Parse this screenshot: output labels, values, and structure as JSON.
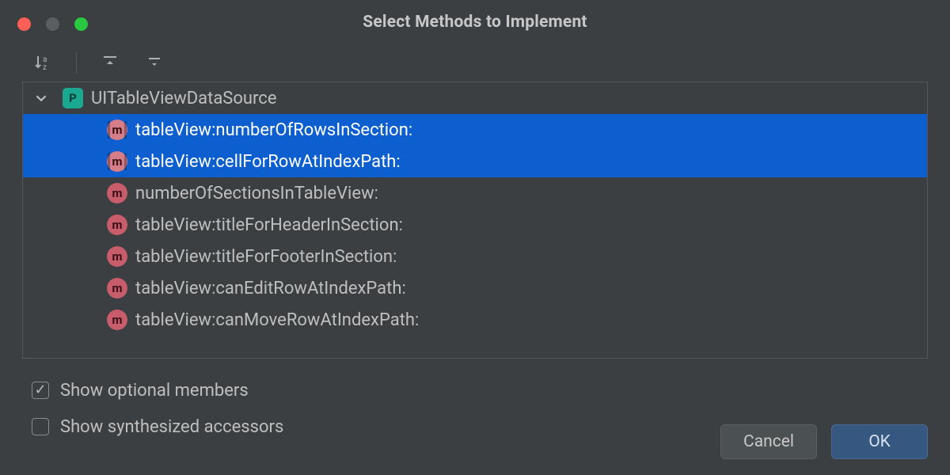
{
  "title": "Select Methods to Implement",
  "toolbar": {
    "sort_az": "sort-alpha",
    "expand_all": "expand-all",
    "collapse_all": "collapse-all"
  },
  "tree": {
    "protocol": {
      "badge": "P",
      "name": "UITableViewDataSource",
      "expanded": true
    },
    "methods": [
      {
        "badge": "m",
        "name": "tableView:numberOfRowsInSection:",
        "selected": true
      },
      {
        "badge": "m",
        "name": "tableView:cellForRowAtIndexPath:",
        "selected": true
      },
      {
        "badge": "m",
        "name": "numberOfSectionsInTableView:",
        "selected": false
      },
      {
        "badge": "m",
        "name": "tableView:titleForHeaderInSection:",
        "selected": false
      },
      {
        "badge": "m",
        "name": "tableView:titleForFooterInSection:",
        "selected": false
      },
      {
        "badge": "m",
        "name": "tableView:canEditRowAtIndexPath:",
        "selected": false
      },
      {
        "badge": "m",
        "name": "tableView:canMoveRowAtIndexPath:",
        "selected": false
      }
    ]
  },
  "options": {
    "show_optional_label": "Show optional members",
    "show_optional_checked": true,
    "show_synth_label": "Show synthesized accessors",
    "show_synth_checked": false
  },
  "buttons": {
    "cancel": "Cancel",
    "ok": "OK"
  }
}
